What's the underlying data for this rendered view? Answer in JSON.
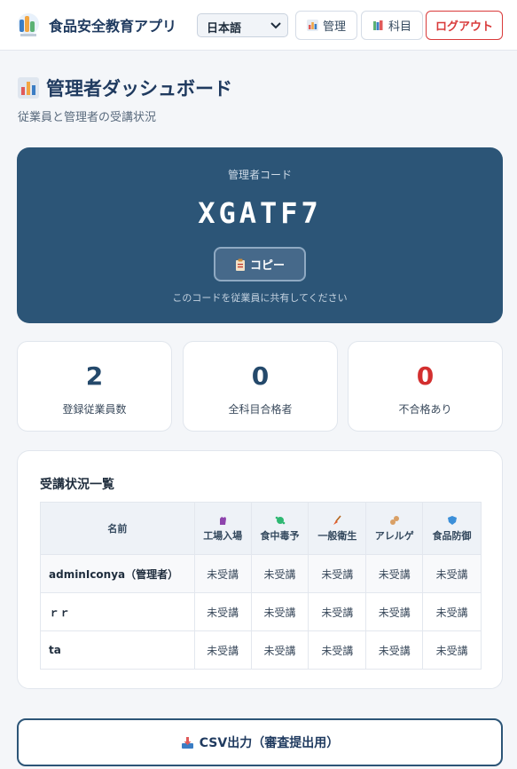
{
  "header": {
    "app_title": "食品安全教育アプリ",
    "language": "日本語",
    "nav_admin": "管理",
    "nav_subject": "科目",
    "logout": "ログアウト"
  },
  "page": {
    "title": "管理者ダッシュボード",
    "subtitle": "従業員と管理者の受講状況"
  },
  "code_card": {
    "label": "管理者コード",
    "code": "XGATF7",
    "copy_label": "コピー",
    "hint": "このコードを従業員に共有してください"
  },
  "stats": [
    {
      "value": "2",
      "label": "登録従業員数"
    },
    {
      "value": "0",
      "label": "全科目合格者"
    },
    {
      "value": "0",
      "label": "不合格あり"
    }
  ],
  "table": {
    "title": "受講状況一覧",
    "name_header": "名前",
    "columns": [
      "工場入場",
      "食中毒予",
      "一般衛生",
      "アレルゲ",
      "食品防御"
    ],
    "rows": [
      {
        "name": "adminIconya（管理者）",
        "cells": [
          "未受講",
          "未受講",
          "未受講",
          "未受講",
          "未受講"
        ]
      },
      {
        "name": "ｒｒ",
        "cells": [
          "未受講",
          "未受講",
          "未受講",
          "未受講",
          "未受講"
        ]
      },
      {
        "name": "ta",
        "cells": [
          "未受講",
          "未受講",
          "未受講",
          "未受講",
          "未受講"
        ]
      }
    ]
  },
  "csv_button": "CSV出力（審査提出用）",
  "colors": {
    "primary": "#2c5577",
    "danger": "#d32f2f",
    "background": "#f4f6f9"
  }
}
